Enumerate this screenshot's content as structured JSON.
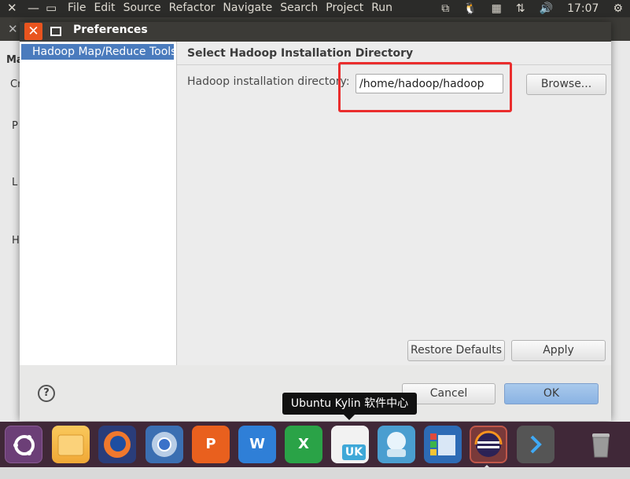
{
  "menubar": {
    "items": [
      "File",
      "Edit",
      "Source",
      "Refactor",
      "Navigate",
      "Search",
      "Project",
      "Run"
    ],
    "clock": "17:07"
  },
  "background_fragments": {
    "f1": "Ma",
    "f2": "Cr",
    "f3": "P",
    "f4": "L",
    "f5": "H"
  },
  "dialog": {
    "title": "Preferences",
    "tree_item": "Hadoop Map/Reduce Tools",
    "heading": "Select Hadoop Installation Directory",
    "dir_label": "Hadoop installation directory:",
    "dir_value": "/home/hadoop/hadoop",
    "browse": "Browse...",
    "restore_defaults": "Restore Defaults",
    "apply": "Apply",
    "help": "?",
    "cancel": "Cancel",
    "ok": "OK"
  },
  "tooltip": "Ubuntu Kylin 软件中心",
  "launcher": {
    "icons": [
      "ubuntu-dash-icon",
      "files-icon",
      "firefox-icon",
      "chromium-icon",
      "wps-presentation-icon",
      "wps-writer-icon",
      "wps-spreadsheet-icon",
      "ubuntu-kylin-software-center-icon",
      "installer-icon",
      "workspace-switcher-icon",
      "eclipse-icon",
      "terminal-icon",
      "trash-icon"
    ],
    "labels": {
      "ppt": "P",
      "word": "W",
      "excel": "X",
      "uk": "UK"
    }
  },
  "colors": {
    "accent": "#e9541e",
    "selection": "#4a7bbd",
    "highlight_box": "#ea2d2d",
    "launcher_bg": "#402838"
  }
}
